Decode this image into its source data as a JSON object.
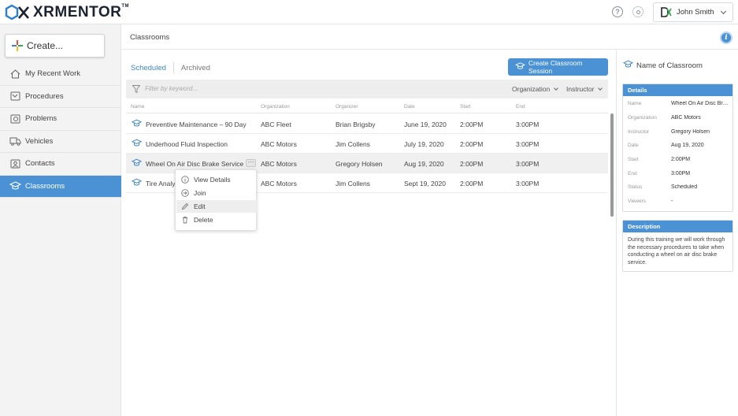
{
  "app": {
    "logo_text": "XRMENTOR",
    "logo_tm": "TM"
  },
  "topbar": {
    "help_icon": "question-circle-icon",
    "settings_icon": "gear-icon",
    "user_name": "John Smith"
  },
  "sidebar": {
    "create_label": "Create...",
    "items": [
      {
        "label": "My Recent Work",
        "icon": "home-icon",
        "active": false
      },
      {
        "label": "Procedures",
        "icon": "procedures-icon",
        "active": false
      },
      {
        "label": "Problems",
        "icon": "problems-icon",
        "active": false
      },
      {
        "label": "Vehicles",
        "icon": "truck-icon",
        "active": false
      },
      {
        "label": "Contacts",
        "icon": "contact-card-icon",
        "active": false
      },
      {
        "label": "Classrooms",
        "icon": "graduation-cap-icon",
        "active": true
      }
    ]
  },
  "main": {
    "title": "Classrooms",
    "tabs": [
      {
        "label": "Scheduled",
        "active": true
      },
      {
        "label": "Archived",
        "active": false
      }
    ],
    "create_session_label": "Create Classroom Session",
    "filter_placeholder": "Filter by keyword...",
    "organization_filter": "Organization",
    "instructor_filter": "Instructor",
    "columns": [
      "Name",
      "Organization",
      "Organizer",
      "Date",
      "Start",
      "End"
    ],
    "rows": [
      {
        "name": "Preventive Maintenance – 90 Day",
        "organization": "ABC Fleet",
        "organizer": "Brian Brigsby",
        "date": "June 19, 2020",
        "start": "2:00PM",
        "end": "3:00PM"
      },
      {
        "name": "Underhood Fluid Inspection",
        "organization": "ABC Motors",
        "organizer": "Jim Collens",
        "date": "July 19, 2020",
        "start": "2:00PM",
        "end": "3:00PM"
      },
      {
        "name": "Wheel On Air Disc Brake Service",
        "organization": "ABC Motors",
        "organizer": "Gregory Holsen",
        "date": "Aug 19, 2020",
        "start": "2:00PM",
        "end": "3:00PM"
      },
      {
        "name": "Tire Analys",
        "organization": "ABC Motors",
        "organizer": "Jim Collens",
        "date": "Sept 19, 2020",
        "start": "2:00PM",
        "end": "3:00PM"
      }
    ],
    "more_label": "···",
    "context_menu": [
      {
        "label": "View Details",
        "icon": "info-icon"
      },
      {
        "label": "Join",
        "icon": "join-icon"
      },
      {
        "label": "Edit",
        "icon": "pencil-icon"
      },
      {
        "label": "Delete",
        "icon": "trash-icon"
      }
    ]
  },
  "panel": {
    "title": "Name of Classroom",
    "details_header": "Details",
    "details": [
      {
        "label": "Name",
        "value": "Wheel On Air Disc Bra..."
      },
      {
        "label": "Organization",
        "value": "ABC Motors"
      },
      {
        "label": "Instructor",
        "value": "Gregory Holsen"
      },
      {
        "label": "Date",
        "value": "Aug 19, 2020"
      },
      {
        "label": "Start",
        "value": "2:00PM"
      },
      {
        "label": "End",
        "value": "3:00PM"
      },
      {
        "label": "Status",
        "value": "Scheduled"
      },
      {
        "label": "Viewers",
        "value": "-"
      }
    ],
    "description_header": "Description",
    "description": "During this training we will work through the necessary procedures to take when conducting a wheel on air disc brake service."
  },
  "colors": {
    "accent": "#4a92d4",
    "sidebar_bg": "#f3f3f3"
  }
}
